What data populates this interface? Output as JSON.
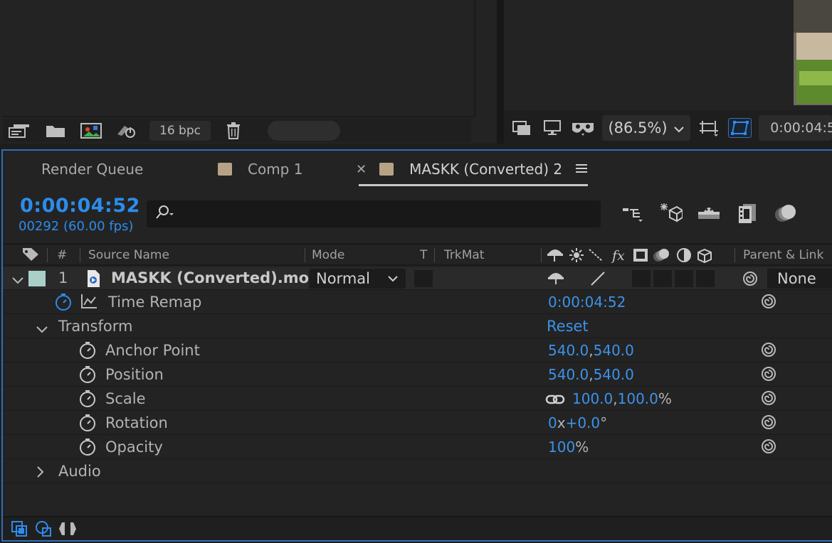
{
  "project_toolbar": {
    "bpc_label": "16 bpc"
  },
  "viewer_toolbar": {
    "zoom_value": "(86.5%)",
    "timecode": "0:00:04:5"
  },
  "tabs": [
    {
      "label": "Render Queue"
    },
    {
      "label": "Comp 1"
    },
    {
      "label": "MASKK (Converted) 2"
    }
  ],
  "timeline": {
    "current_time": "0:00:04:52",
    "frame_info": "00292 (60.00 fps)",
    "search_placeholder": ""
  },
  "columns": {
    "number": "#",
    "source_name": "Source Name",
    "mode": "Mode",
    "t": "T",
    "trkmat": "TrkMat",
    "parent_link": "Parent & Link"
  },
  "layer": {
    "index": "1",
    "name": "MASKK (Converted).mov",
    "mode": "Normal",
    "parent": "None"
  },
  "properties": {
    "time_remap": {
      "label": "Time Remap",
      "value": "0:00:04:52"
    },
    "transform": {
      "label": "Transform",
      "value": "Reset"
    },
    "anchor_point": {
      "label": "Anchor Point",
      "x": "540.0",
      "y": "540.0"
    },
    "position": {
      "label": "Position",
      "x": "540.0",
      "y": "540.0"
    },
    "scale": {
      "label": "Scale",
      "x": "100.0",
      "y": "100.0",
      "unit": "%"
    },
    "rotation": {
      "label": "Rotation",
      "revs": "0",
      "revs_sep": "x",
      "deg": "+0.0",
      "unit": "°"
    },
    "opacity": {
      "label": "Opacity",
      "value": "100",
      "unit": "%"
    },
    "audio": {
      "label": "Audio"
    }
  },
  "colors": {
    "accent": "#2d8ceb",
    "label_swatch": "#a9cfc9",
    "comp_swatch": "#b8a286"
  }
}
